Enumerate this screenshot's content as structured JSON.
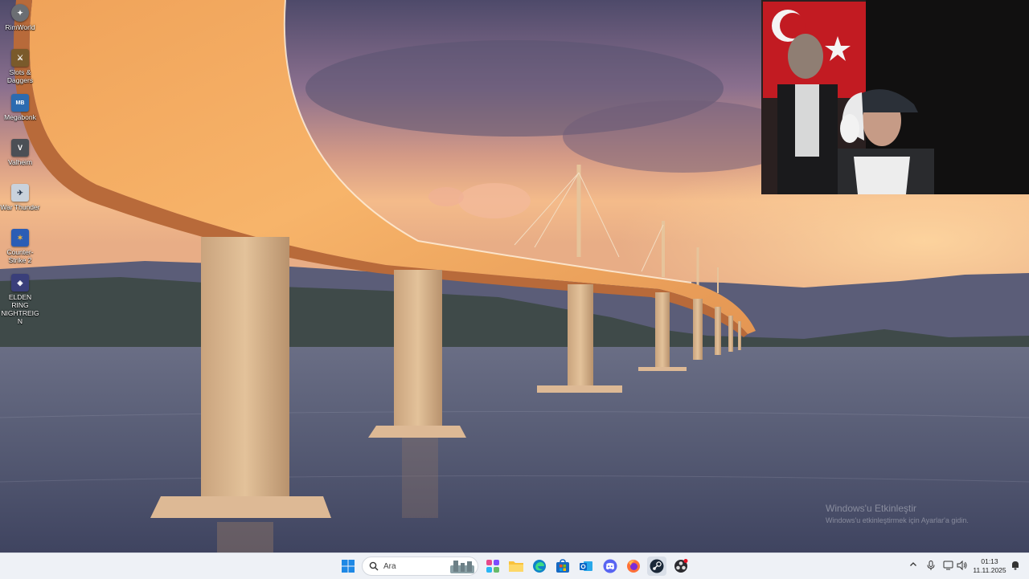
{
  "desktop": {
    "icons": [
      {
        "label": "RimWorld",
        "icon": "rimworld-icon",
        "color": "#6b6e73"
      },
      {
        "label": "Slots & Daggers",
        "icon": "slots-daggers-icon",
        "color": "#7a5a2b"
      },
      {
        "label": "Megabonk",
        "icon": "megabonk-icon",
        "color": "#2c6bb0"
      },
      {
        "label": "Valheim",
        "icon": "valheim-icon",
        "color": "#4b4f55"
      },
      {
        "label": "War Thunder",
        "icon": "war-thunder-icon",
        "color": "#c9d2dc"
      },
      {
        "label": "Counter-Strike 2",
        "icon": "counter-strike-icon",
        "color": "#2b5db5"
      },
      {
        "label": "ELDEN RING NIGHTREIGN",
        "icon": "elden-ring-icon",
        "color": "#3a3f7a"
      }
    ]
  },
  "watermark": {
    "title": "Windows'u Etkinleştir",
    "subtitle": "Windows'u etkinleştirmek için Ayarlar'a gidin."
  },
  "taskbar": {
    "start_icon": "windows-start-icon",
    "search_placeholder": "Ara",
    "pinned": [
      {
        "name": "widgets-icon"
      },
      {
        "name": "file-explorer-icon"
      },
      {
        "name": "edge-icon"
      },
      {
        "name": "microsoft-store-icon"
      },
      {
        "name": "outlook-icon"
      },
      {
        "name": "discord-icon"
      },
      {
        "name": "firefox-icon"
      },
      {
        "name": "steam-icon"
      },
      {
        "name": "obs-icon"
      }
    ],
    "tray": {
      "chevron_icon": "chevron-up-icon",
      "mic_icon": "microphone-icon",
      "network_icon": "network-icon",
      "volume_icon": "volume-icon",
      "notification_icon": "notification-icon"
    },
    "clock": {
      "time": "01:13",
      "date": "11.11.2025"
    }
  }
}
